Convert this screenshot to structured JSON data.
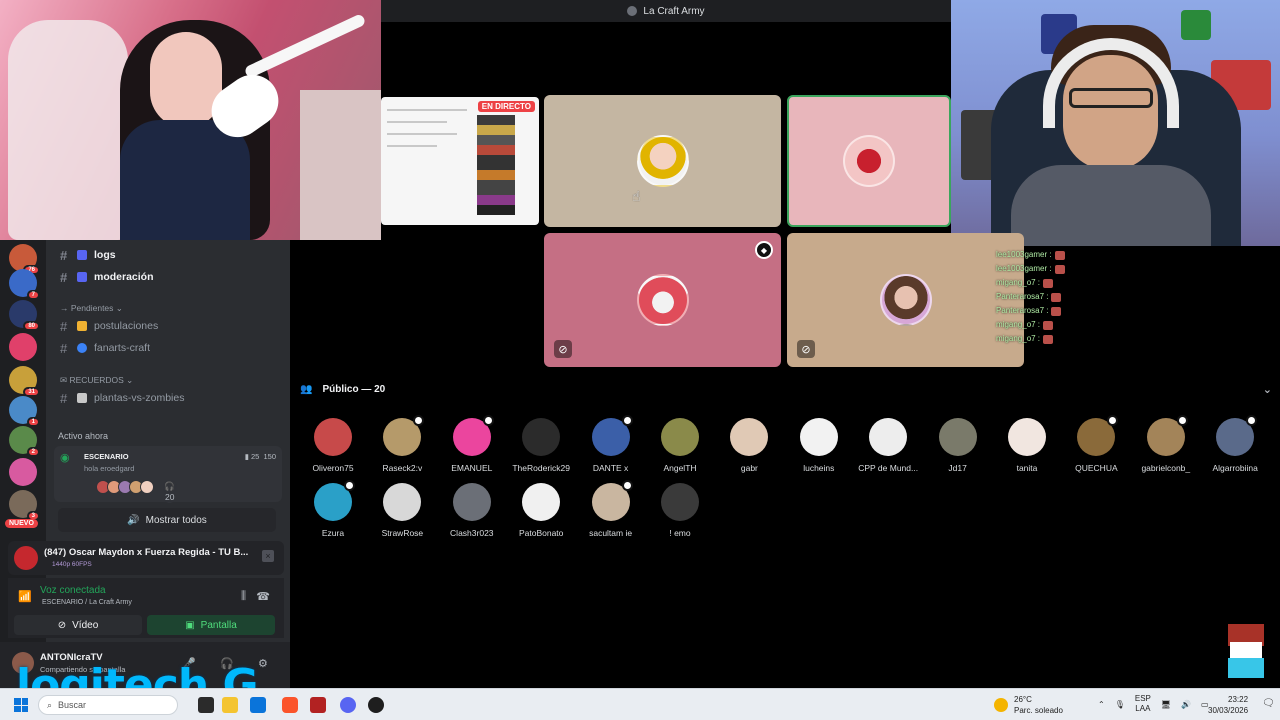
{
  "call": {
    "title": "La Craft Army",
    "live_badge": "EN DIRECTO"
  },
  "stream_chat": [
    {
      "user": "lee1003gamer :"
    },
    {
      "user": "lee1003gamer :"
    },
    {
      "user": "migang_o7 :"
    },
    {
      "user": "Panterarosa7 :"
    },
    {
      "user": "Panterarosa7 :"
    },
    {
      "user": "migang_o7 :"
    },
    {
      "user": "migang_o7 :"
    }
  ],
  "audience": {
    "header": "Público — 20",
    "members": [
      {
        "name": "Oliveron75",
        "color": "#c74a4a",
        "mod": false
      },
      {
        "name": "Raseck2:v",
        "color": "#b59a6a",
        "mod": true
      },
      {
        "name": "EMANUEL",
        "color": "#eb459e",
        "mod": true
      },
      {
        "name": "TheRoderick29",
        "color": "#2b2b2b",
        "mod": false
      },
      {
        "name": "DANTE x",
        "color": "#3b5fa8",
        "mod": true
      },
      {
        "name": "AngelTH",
        "color": "#8a8a4a",
        "mod": false
      },
      {
        "name": "gabr",
        "color": "#e0c9b5",
        "mod": false
      },
      {
        "name": "lucheins",
        "color": "#f2f2f2",
        "mod": false
      },
      {
        "name": "CPP de Mund...",
        "color": "#ededed",
        "mod": false
      },
      {
        "name": "Jd17",
        "color": "#7a7a6a",
        "mod": false
      },
      {
        "name": "tanita",
        "color": "#f1e6e0",
        "mod": false
      },
      {
        "name": "QUECHUA",
        "color": "#8a6a3a",
        "mod": true
      },
      {
        "name": "gabrielconb_",
        "color": "#a38459",
        "mod": true
      },
      {
        "name": "Algarrobiina",
        "color": "#5a6a8a",
        "mod": true
      },
      {
        "name": "Ezura",
        "color": "#2aa0c8",
        "mod": true
      },
      {
        "name": "StrawRose",
        "color": "#d8d8d8",
        "mod": false
      },
      {
        "name": "Clash3r023",
        "color": "#6b6f77",
        "mod": false
      },
      {
        "name": "PatoBonato",
        "color": "#f0f0f0",
        "mod": false
      },
      {
        "name": "sacultam ie",
        "color": "#c9b6a0",
        "mod": true
      },
      {
        "name": "! emo",
        "color": "#3a3a3a",
        "mod": false
      }
    ]
  },
  "sidebar": {
    "channels_top": [
      {
        "name": "logs",
        "icon_color": "#5865f2"
      },
      {
        "name": "moderación",
        "icon_color": "#5865f2"
      }
    ],
    "category_pending": "Pendientes",
    "channels_pending": [
      {
        "name": "postulaciones",
        "icon_color": "#f0b232"
      },
      {
        "name": "fanarts-craft",
        "icon_color": "#3b82f6"
      }
    ],
    "category_memories": "RECUERDOS",
    "channels_memories": [
      {
        "name": "plantas-vs-zombies",
        "icon_color": "#c8c8c8"
      }
    ],
    "active_now": "Activo ahora",
    "activity": {
      "title": "ESCENARIO",
      "subtitle": "hola eroedgard",
      "cam_count": "25",
      "listeners": "150",
      "people_count": "20"
    },
    "show_all": "Mostrar todos",
    "server_badges": [
      "76",
      "7",
      "80",
      "",
      "31",
      "1",
      "2",
      "",
      "3"
    ],
    "new_badge": "NUEVO"
  },
  "now_playing": {
    "title": "(847) Oscar Maydon x Fuerza Regida - TU B...",
    "quality": "1440p 60FPS"
  },
  "voice": {
    "status": "Voz conectada",
    "location": "ESCENARIO / La Craft Army",
    "video_label": "Vídeo",
    "screen_label": "Pantalla"
  },
  "user": {
    "name": "ANTONIcraTV",
    "status": "Compartiendo su pantalla"
  },
  "overlay": {
    "brand": "logitech G"
  },
  "taskbar": {
    "search": "Buscar",
    "weather_temp": "26°C",
    "weather_desc": "Parc. soleado",
    "lang_1": "ESP",
    "lang_2": "LAA",
    "time": "23:22",
    "date": "30/03/2026"
  }
}
